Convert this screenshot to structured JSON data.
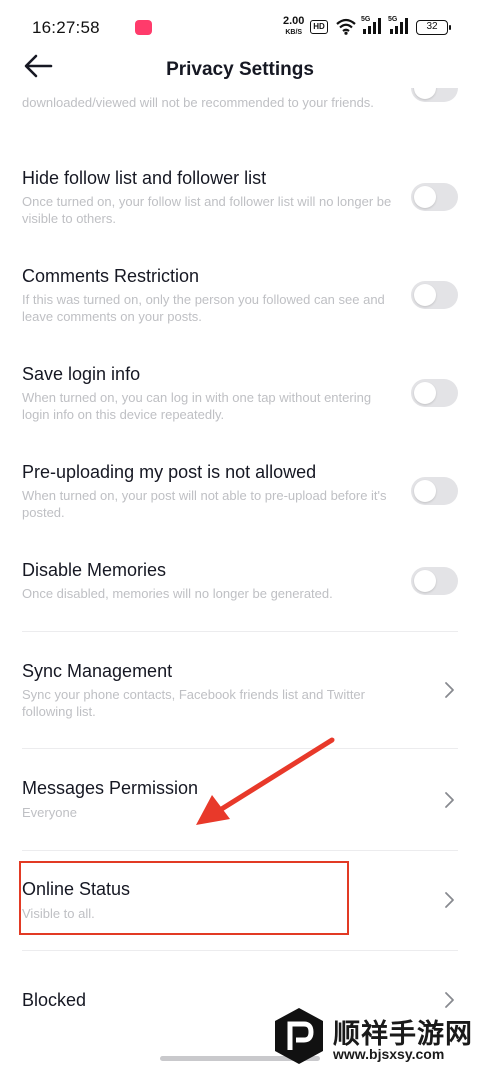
{
  "status_bar": {
    "time": "16:27:58",
    "net_speed_value": "2.00",
    "net_speed_unit": "KB/S",
    "hd_label": "HD",
    "signal_1_label": "5G",
    "signal_2_label": "5G",
    "battery": "32"
  },
  "header": {
    "title": "Privacy Settings",
    "back_icon": "arrow-left-icon"
  },
  "settings": {
    "partial_row": {
      "description": "downloaded/viewed will not be recommended to your friends.",
      "toggle_on": false
    },
    "hide_follow_list": {
      "title": "Hide follow list and follower list",
      "description": "Once turned on, your follow list and follower list will no longer be visible to others.",
      "toggle_on": false
    },
    "comments_restriction": {
      "title": "Comments Restriction",
      "description": "If this was turned on, only the person you followed can see and leave comments on your posts.",
      "toggle_on": false
    },
    "save_login_info": {
      "title": "Save login info",
      "description": "When turned on, you can log in with one tap without entering login info on this device repeatedly.",
      "toggle_on": false
    },
    "pre_uploading": {
      "title": "Pre-uploading my post is not allowed",
      "description": "When turned on, your post will not able to pre-upload before it's posted.",
      "toggle_on": false
    },
    "disable_memories": {
      "title": "Disable Memories",
      "description": "Once disabled, memories will no longer be generated.",
      "toggle_on": false
    },
    "sync_management": {
      "title": "Sync Management",
      "description": "Sync your phone contacts, Facebook friends list and Twitter following list."
    },
    "messages_permission": {
      "title": "Messages Permission",
      "value": "Everyone"
    },
    "online_status": {
      "title": "Online Status",
      "value": "Visible to all."
    },
    "blocked": {
      "title": "Blocked"
    }
  },
  "annotation": {
    "highlight_color": "#e23a24",
    "arrow_color": "#e8392a"
  },
  "watermark": {
    "text": "顺祥手游网",
    "url": "www.bjsxsy.com"
  },
  "colors": {
    "title_text": "#161823",
    "desc_text": "#bfc0c4",
    "toggle_off": "#e3e3e6"
  }
}
